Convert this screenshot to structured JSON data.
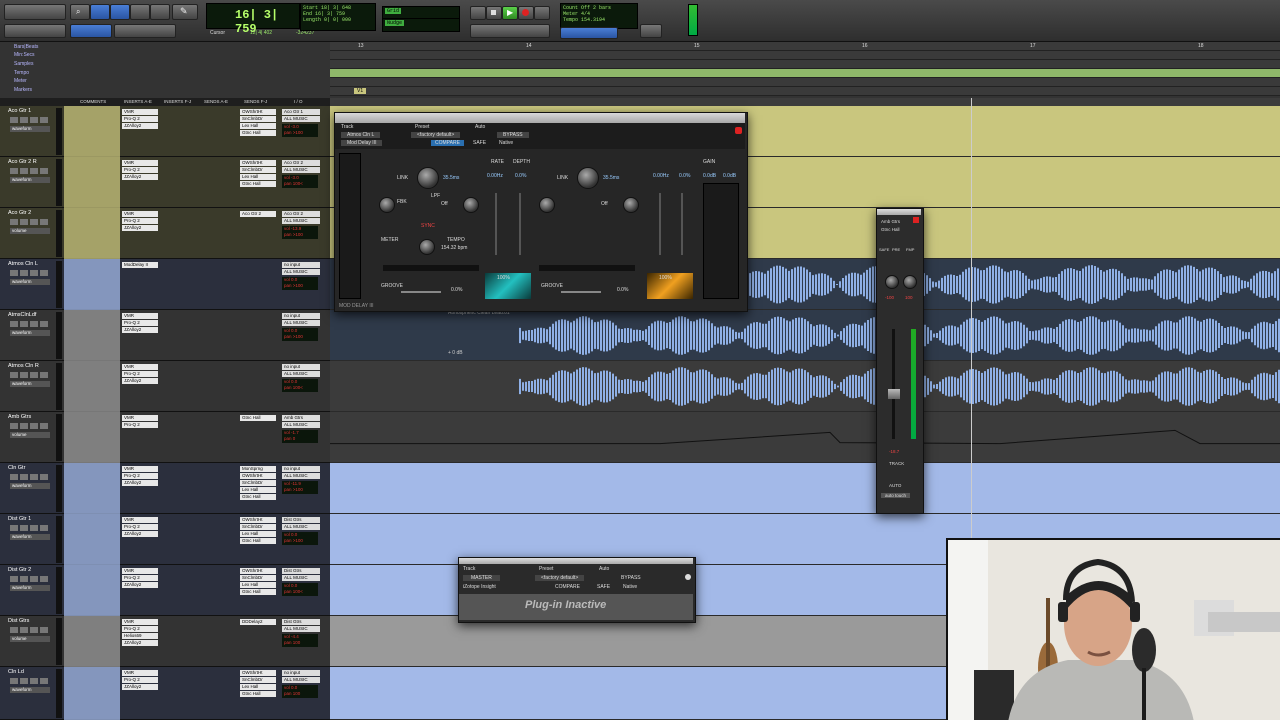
{
  "toolbar": {
    "counter_main": "16| 3| 759",
    "counter_labels": [
      "Start",
      "End",
      "Length"
    ],
    "counter_values": [
      "18| 3| 648",
      "16| 3| 759",
      "0| 0| 000"
    ],
    "grid_label": "Grid",
    "nudge_label": "Nudge",
    "cursor_label": "Cursor",
    "cursor_value": "12| 4| 402",
    "cursor_samples": "-324237",
    "count_off_label": "Count Off",
    "meter_label": "Meter",
    "tempo_label": "Tempo",
    "count_bars": "2 bars",
    "meter_value": "4/4",
    "tempo_value": "154.3194"
  },
  "rulers": {
    "labels": [
      "Bars|Beats",
      "Min:Secs",
      "Samples",
      "Tempo",
      "Meter",
      "Markers"
    ],
    "bar_numbers": [
      "13",
      "14",
      "15",
      "16",
      "17",
      "18"
    ],
    "marker_label": "V1"
  },
  "columns": [
    "COMMENTS",
    "INSERTS A-E",
    "INSERTS F-J",
    "SENDS A-E",
    "SENDS F-J",
    "I / O"
  ],
  "tracks": [
    {
      "name": "Aco Gtr 1",
      "view": "waveform",
      "inserts": [
        "VMR",
        "Pro-Q 2",
        "JZAlloy2"
      ],
      "sends": [
        "OWShrtHt",
        "SnClmbDr",
        "Lex Hall",
        "Gtnc Hall"
      ],
      "io_in": "Aco Gtr 1",
      "io_out": "ALL MUSIC",
      "vol": "vol -3.0",
      "pan": "pan >100",
      "color": "yellow"
    },
    {
      "name": "Aco Gtr 2 R",
      "view": "waveform",
      "inserts": [
        "VMR",
        "Pro-Q 2",
        "JZAlloy2"
      ],
      "sends": [
        "OWShrtHt",
        "SnClmbDr",
        "Lex Hall",
        "Gtnc Hall"
      ],
      "io_in": "Aco Gtr 2",
      "io_out": "ALL MUSIC",
      "vol": "vol -3.0",
      "pan": "pan 100<",
      "color": "yellow"
    },
    {
      "name": "Aco Gtr 2",
      "view": "volume",
      "inserts": [
        "VMR",
        "Pro-Q 2",
        "JZAlloy2"
      ],
      "sends": [
        "Aco Gtr 2"
      ],
      "io_in": "Aco Gtr 2",
      "io_out": "ALL MUSIC",
      "vol": "vol -13.9",
      "pan": "pan >100",
      "color": "yellow"
    },
    {
      "name": "Atmos Cln L",
      "view": "waveform",
      "inserts": [
        "ModDelay II"
      ],
      "sends": [],
      "io_in": "no input",
      "io_out": "ALL MUSIC",
      "vol": "vol 0.0",
      "pan": "pan >100",
      "color": "blue"
    },
    {
      "name": "AtmsClnLdf",
      "view": "waveform",
      "inserts": [
        "VMR",
        "Pro-Q 2",
        "JZAlloy2"
      ],
      "sends": [],
      "io_in": "no input",
      "io_out": "ALL MUSIC",
      "vol": "vol 0.0",
      "pan": "pan >100",
      "color": "grey"
    },
    {
      "name": "Atmos Cln R",
      "view": "waveform",
      "inserts": [
        "VMR",
        "Pro-Q 2",
        "JZAlloy2"
      ],
      "sends": [],
      "io_in": "no input",
      "io_out": "ALL MUSIC",
      "vol": "vol 0.0",
      "pan": "pan 100<",
      "color": "grey"
    },
    {
      "name": "Amb Gtrs",
      "view": "volume",
      "inserts": [
        "VMR",
        "Pro-Q 2"
      ],
      "sends": [
        "Gtnc Hall"
      ],
      "io_in": "Amb Gtrs",
      "io_out": "ALL MUSIC",
      "vol": "vol -1.7",
      "pan": "pan 0",
      "color": "grey"
    },
    {
      "name": "Cln Gtr",
      "view": "waveform",
      "inserts": [
        "VMR",
        "Pro-Q 2",
        "JZAlloy2"
      ],
      "sends": [
        "MonSprng",
        "OWShrtHt",
        "SnClmbDr",
        "Lex Hall",
        "Gtnc Hall"
      ],
      "io_in": "no input",
      "io_out": "ALL MUSIC",
      "vol": "vol -11.9",
      "pan": "pan >100",
      "color": "blue"
    },
    {
      "name": "Dist Gtr 1",
      "view": "waveform",
      "inserts": [
        "VMR",
        "Pro-Q 2",
        "JZAlloy2"
      ],
      "sends": [
        "OWShrtHt",
        "SnClmbDr",
        "Lex Hall",
        "Gtnc Hall"
      ],
      "io_in": "Dist Gtrs",
      "io_out": "ALL MUSIC",
      "vol": "vol 0.0",
      "pan": "pan >100",
      "color": "blue"
    },
    {
      "name": "Dist Gtr 2",
      "view": "waveform",
      "inserts": [
        "VMR",
        "Pro-Q 2",
        "JZAlloy2"
      ],
      "sends": [
        "OWShrtHt",
        "SnClmbDr",
        "Lex Hall",
        "Gtnc Hall"
      ],
      "io_in": "Dist Gtrs",
      "io_out": "ALL MUSIC",
      "vol": "vol 0.0",
      "pan": "pan 100<",
      "color": "blue"
    },
    {
      "name": "Dist Gtrs",
      "view": "volume",
      "inserts": [
        "VMR",
        "Pro-Q 2",
        "Helios69",
        "JZAlloy2"
      ],
      "sends": [
        "DDDelay2"
      ],
      "io_in": "Dist Gtrs",
      "io_out": "ALL MUSIC",
      "vol": "vol -4.4",
      "pan": "pan 100",
      "color": "grey"
    },
    {
      "name": "Cln Ld",
      "view": "waveform",
      "inserts": [
        "VMR",
        "Pro-Q 2",
        "JZAlloy2"
      ],
      "sends": [
        "OWShrtHt",
        "SnClmbDr",
        "Lex Hall",
        "Gtnc Hall"
      ],
      "io_in": "no input",
      "io_out": "ALL MUSIC",
      "vol": "vol 0.0",
      "pan": "pan 100",
      "color": "blue"
    }
  ],
  "clip_label": "Atmospheric Clean Lead.01",
  "clip_gain": "+ 0 dB",
  "mod_delay": {
    "track_label": "Track",
    "preset_label": "Preset",
    "auto_label": "Auto",
    "track_name": "Atmos Cln L",
    "preset_name": "<factory default>",
    "insert_name": "Mod Delay III",
    "compare": "COMPARE",
    "bypass": "BYPASS",
    "safe": "SAFE",
    "native": "Native",
    "delay_l": "35.5ms",
    "delay_r": "35.5ms",
    "depth_l": "0.00Hz",
    "depth_r": "0.00Hz",
    "rate_l": "0.0%",
    "rate_r": "0.0%",
    "link": "LINK",
    "fbk": "FBK",
    "lpf": "LPF",
    "off_l": "Off",
    "off_r": "Off",
    "sync": "SYNC",
    "meter": "METER",
    "tempo": "TEMPO",
    "bpm": "154.32 bpm",
    "groove_l": "GROOVE",
    "groove_r": "GROOVE",
    "groove_val_l": "0.0%",
    "groove_val_r": "0.0%",
    "mix_l": "100%",
    "mix_r": "100%",
    "out_l": "0.0dB",
    "out_r": "0.0dB",
    "brand": "MOD DELAY III",
    "rate_label": "RATE",
    "depth_label": "DEPTH",
    "gain_label": "GAIN"
  },
  "inactive_plugin": {
    "track_label": "Track",
    "preset_label": "Preset",
    "auto_label": "Auto",
    "track_name": "MASTER",
    "preset_name": "<factory default>",
    "insert_name": "iZotope Insight",
    "compare": "COMPARE",
    "bypass": "BYPASS",
    "safe": "SAFE",
    "native": "Native",
    "message": "Plug-in Inactive"
  },
  "output_window": {
    "title": "Amb Gtrs",
    "send": "Gtnc Hall",
    "pan_l": "-100",
    "pan_r": "100",
    "vol": "-18.7",
    "track_btn": "TRACK",
    "auto_btn": "AUTO",
    "auto_mode": "auto touch",
    "buttons": [
      "SAFE",
      "PRE",
      "FMP"
    ]
  },
  "colors": {
    "yellow_track": "#c9c67e",
    "blue_track": "#a3b9e8",
    "grey_track": "#9a9a9a",
    "waveform": "#8fb0e6",
    "clip_dark": "#2f3a4a",
    "ruler_green": "#8fb86a",
    "counter_green": "#b6ff6a"
  }
}
